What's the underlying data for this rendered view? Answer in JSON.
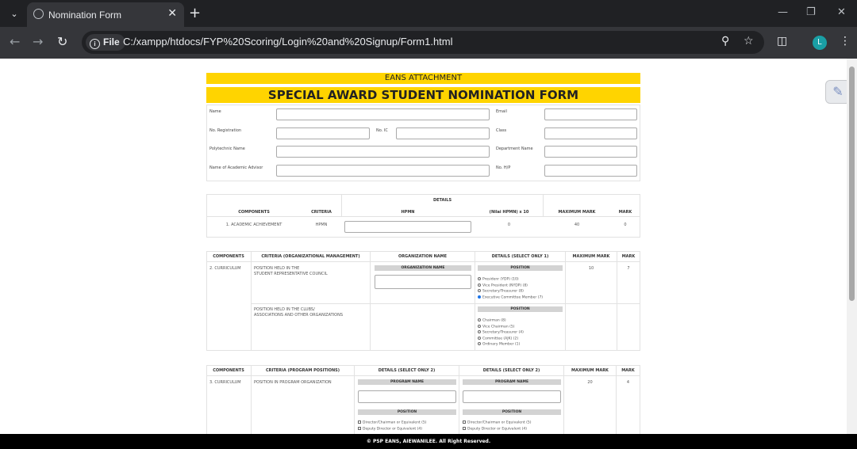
{
  "browser": {
    "tab_title": "Nomination Form",
    "url_chip": "File",
    "url": "C:/xampp/htdocs/FYP%20Scoring/Login%20and%20Signup/Form1.html",
    "avatar_letter": "L"
  },
  "form": {
    "banner_small": "EANS ATTACHMENT",
    "banner_title": "SPECIAL AWARD STUDENT NOMINATION FORM",
    "fields": {
      "name": "Name",
      "email": "Email",
      "reg_no": "No. Registration",
      "ic_no": "No. IC",
      "class": "Class",
      "polytechnic": "Polytechnic Name",
      "department": "Department Name",
      "advisor": "Name of Academic Advisor",
      "hp_no": "No. H/P"
    }
  },
  "academic": {
    "details_header": "DETAILS",
    "col_components": "COMPONENTS",
    "col_criteria": "CRITERIA",
    "col_hpmn": "HPMN",
    "col_formula": "(Nilai HPMN) x 10",
    "col_max": "MAXIMUM MARK",
    "col_mark": "MARK",
    "row_component": "1. ACADEMIC ACHIEVEMENT",
    "row_criteria": "HPMN",
    "row_formula": "0",
    "row_max": "40",
    "row_mark": "0"
  },
  "org": {
    "col_components": "COMPONENTS",
    "col_criteria": "CRITERIA (ORGANIZATIONAL MANAGEMENT)",
    "col_org_name": "ORGANIZATION NAME",
    "col_details": "DETAILS (SELECT ONLY 1)",
    "col_max": "MAXIMUM MARK",
    "col_mark": "MARK",
    "component": "2. CURRICULUM",
    "criteria1_line1": "POSITION HELD IN THE",
    "criteria1_line2": "STUDENT REPRESENTATIVE COUNCIL",
    "org_name_header": "ORGANIZATION NAME",
    "position_header": "POSITION",
    "src_options": [
      {
        "label": "Presidenr (YDP) (10)",
        "checked": false
      },
      {
        "label": "Vice President (NYDP) (8)",
        "checked": false
      },
      {
        "label": "Secretary/Treasurer (8)",
        "checked": false
      },
      {
        "label": "Executive Committee Member (7)",
        "checked": true
      }
    ],
    "max1": "10",
    "mark1": "7",
    "criteria2_line1": "POSITION HELD IN THE CLUBS/",
    "criteria2_line2": "ASSOCIATIONS AND OTHER ORGANIZATIONS",
    "position_header2": "POSITION",
    "club_options": [
      {
        "label": "Chairman (8)",
        "checked": false
      },
      {
        "label": "Vice Chairman (5)",
        "checked": false
      },
      {
        "label": "Secretary/Treasurer (4)",
        "checked": false
      },
      {
        "label": "Committee (AJK) (2)",
        "checked": false
      },
      {
        "label": "Ordinary Member (1)",
        "checked": false
      }
    ]
  },
  "program": {
    "col_components": "COMPONENTS",
    "col_criteria": "CRITERIA (PROGRAM POSITIONS)",
    "col_details1": "DETAILS (SELECT ONLY 2)",
    "col_details2": "DETAILS (SELECT ONLY 2)",
    "col_max": "MAXIMUM MARK",
    "col_mark": "MARK",
    "component": "3. CURRICULUM",
    "criteria": "POSITION IN PROGRAM ORGANIZATION",
    "program_name_header": "PROGRAM NAME",
    "position_header": "POSITION",
    "options_left": [
      "Director/Chairman or Equivalent (5)",
      "Deputy Director or Equivalent (4)"
    ],
    "options_right": [
      "Director/Chairman or Equivalent (5)",
      "Deputy Director or Equivalent (4)"
    ],
    "max": "20",
    "mark": "4"
  },
  "footer": {
    "text": "© PSP EANS, AIEWANILEE. All Right Reserved."
  }
}
